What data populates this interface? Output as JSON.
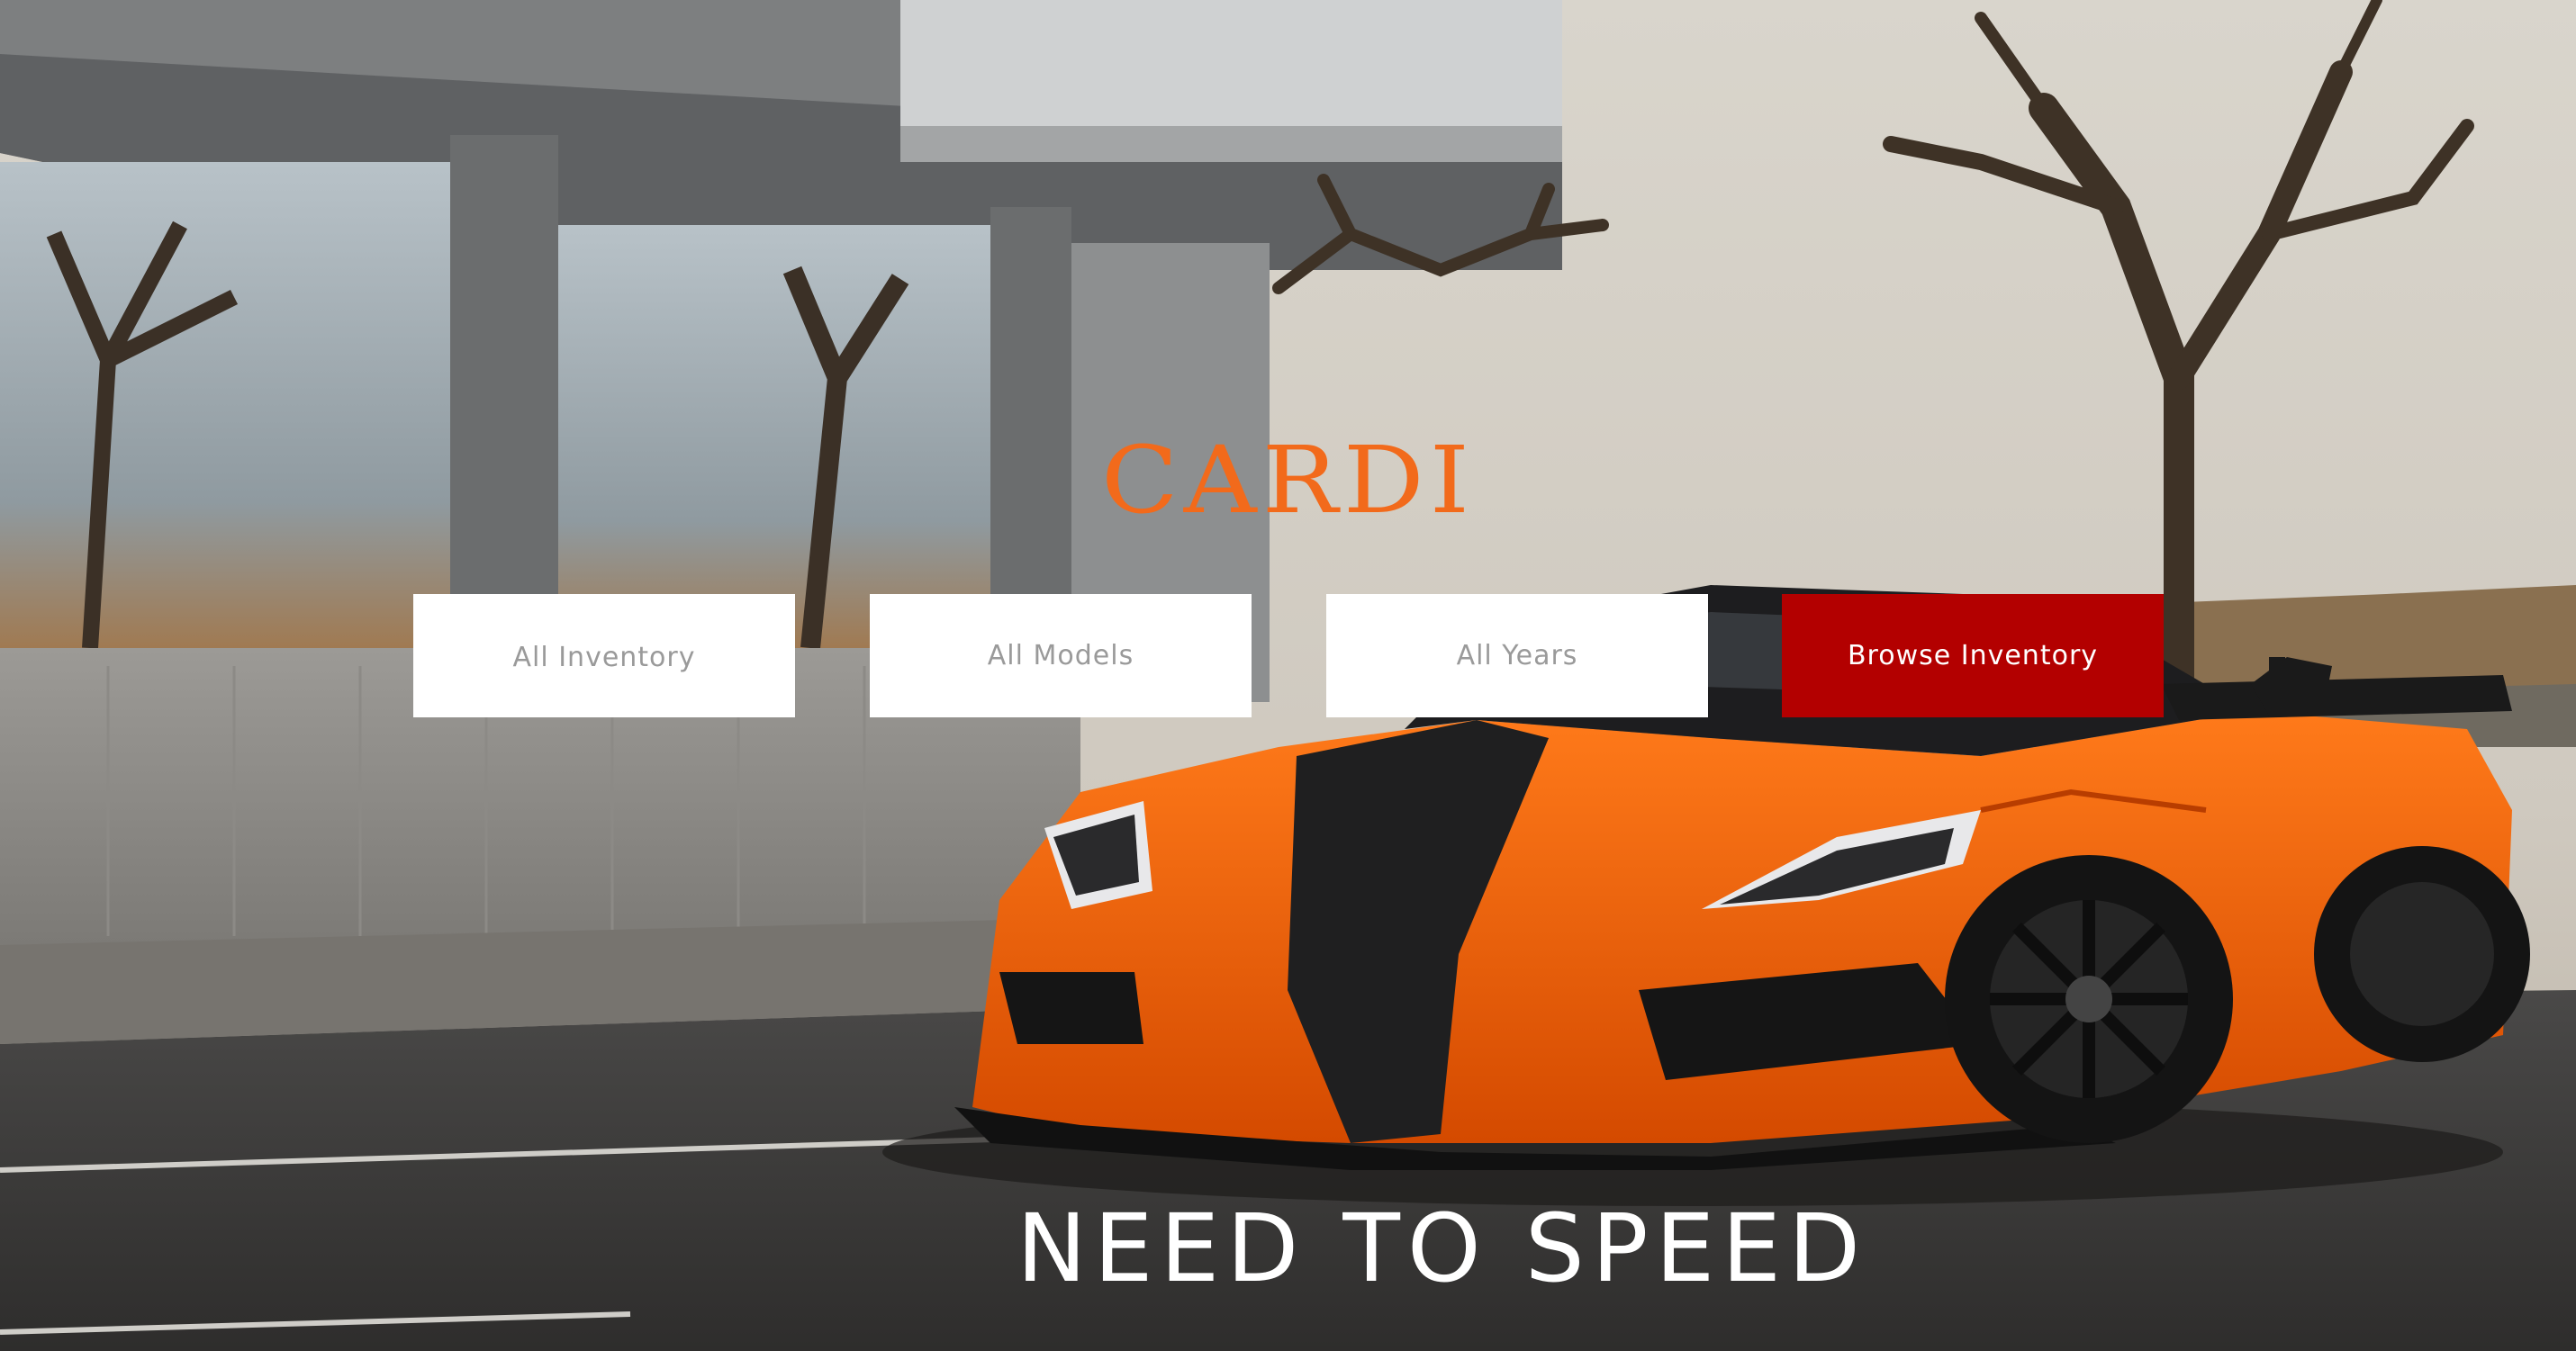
{
  "brand": {
    "name": "CARDI",
    "color": "#f26a1b"
  },
  "search": {
    "inventory_select": "All Inventory",
    "models_select": "All Models",
    "years_select": "All Years",
    "browse_button": "Browse Inventory",
    "button_color": "#b30000"
  },
  "hero": {
    "tagline": "NEED TO SPEED",
    "background_subject": "orange and black supercar parked in front of a building"
  }
}
